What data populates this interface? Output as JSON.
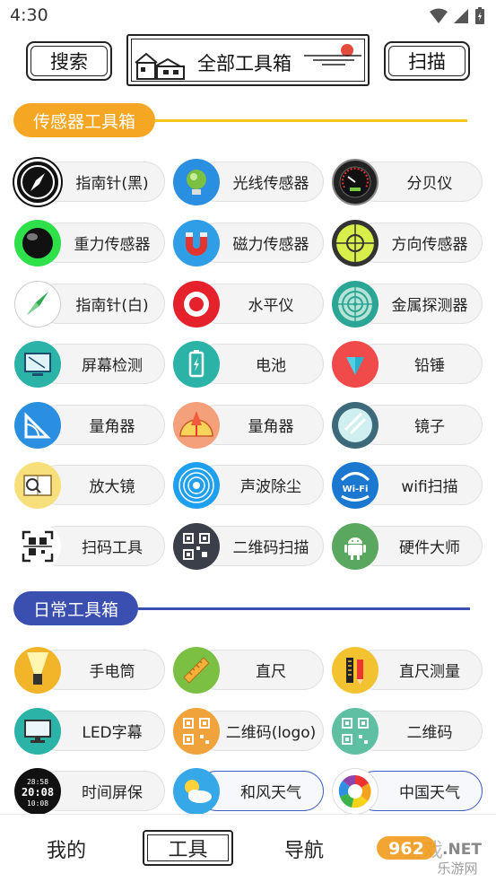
{
  "status_bar": {
    "time": "4:30"
  },
  "header": {
    "search_label": "搜索",
    "title": "全部工具箱",
    "scan_label": "扫描"
  },
  "sections": [
    {
      "title": "传感器工具箱",
      "color": "#f5a623"
    },
    {
      "title": "日常工具箱",
      "color": "#3a4fb0"
    }
  ],
  "sensor_tools": [
    {
      "label": "指南针(黑)",
      "icon": "compass-black-icon"
    },
    {
      "label": "光线传感器",
      "icon": "light-sensor-icon"
    },
    {
      "label": "分贝仪",
      "icon": "decibel-meter-icon"
    },
    {
      "label": "重力传感器",
      "icon": "gravity-ball-icon"
    },
    {
      "label": "磁力传感器",
      "icon": "magnet-icon"
    },
    {
      "label": "方向传感器",
      "icon": "orientation-level-icon"
    },
    {
      "label": "指南针(白)",
      "icon": "compass-white-icon"
    },
    {
      "label": "水平仪",
      "icon": "level-target-icon"
    },
    {
      "label": "金属探测器",
      "icon": "metal-radar-icon"
    },
    {
      "label": "屏幕检测",
      "icon": "screen-test-icon"
    },
    {
      "label": "电池",
      "icon": "battery-icon"
    },
    {
      "label": "铅锤",
      "icon": "plumb-bob-icon"
    },
    {
      "label": "量角器",
      "icon": "set-square-icon"
    },
    {
      "label": "量角器",
      "icon": "protractor-icon"
    },
    {
      "label": "镜子",
      "icon": "mirror-icon"
    },
    {
      "label": "放大镜",
      "icon": "magnifier-book-icon"
    },
    {
      "label": "声波除尘",
      "icon": "sound-wave-icon"
    },
    {
      "label": "wifi扫描",
      "icon": "wifi-scan-icon"
    },
    {
      "label": "扫码工具",
      "icon": "scan-code-icon"
    },
    {
      "label": "二维码扫描",
      "icon": "qr-scan-icon"
    },
    {
      "label": "硬件大师",
      "icon": "android-icon"
    }
  ],
  "daily_tools": [
    {
      "label": "手电筒",
      "icon": "flashlight-icon"
    },
    {
      "label": "直尺",
      "icon": "ruler-icon"
    },
    {
      "label": "直尺测量",
      "icon": "ruler-pencil-icon"
    },
    {
      "label": "LED字幕",
      "icon": "monitor-icon"
    },
    {
      "label": "二维码(logo)",
      "icon": "qr-logo-icon"
    },
    {
      "label": "二维码",
      "icon": "qr-code-icon"
    },
    {
      "label": "时间屏保",
      "icon": "digital-clock-icon"
    },
    {
      "label": "和风天气",
      "icon": "weather-icon"
    },
    {
      "label": "中国天气",
      "icon": "china-weather-icon"
    }
  ],
  "clock_icon_text": {
    "top": "28:58",
    "mid": "20:08",
    "bot": "10:08"
  },
  "wifi_icon_text": "Wi-Fi",
  "bottom_nav": {
    "mine": "我的",
    "tools": "工具",
    "nav": "导航",
    "fun": "游戏"
  },
  "watermark": {
    "brand": "962",
    "net": ".NET",
    "site": "乐游网"
  }
}
